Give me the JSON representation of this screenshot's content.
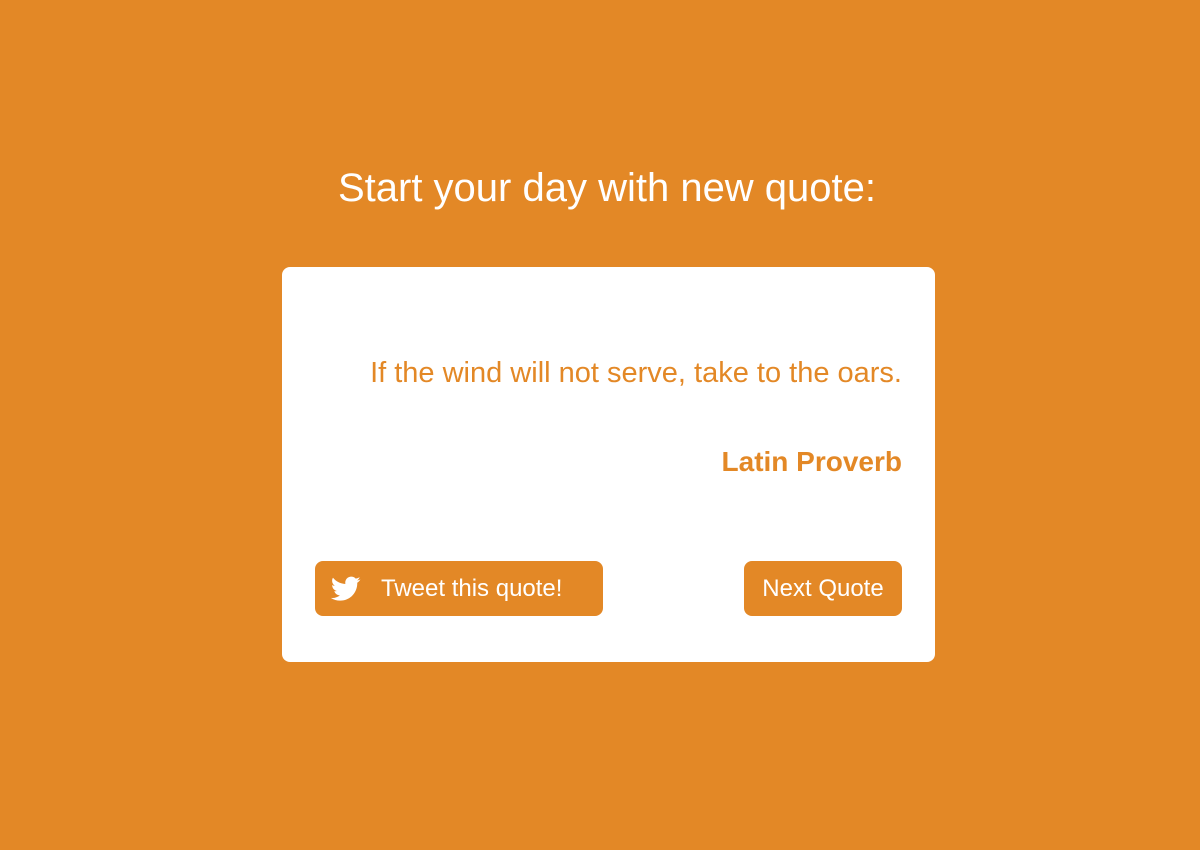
{
  "header": {
    "title": "Start your day with new quote:"
  },
  "quote": {
    "text": "If the wind will not serve, take to the oars.",
    "author": "Latin Proverb"
  },
  "actions": {
    "tweet_label": "Tweet this quote!",
    "tweet_icon": "twitter-bird-icon",
    "next_label": "Next Quote"
  },
  "colors": {
    "background": "#E38826",
    "card": "#FFFFFF",
    "accent": "#E38826",
    "text_on_accent": "#FFFFFF"
  }
}
